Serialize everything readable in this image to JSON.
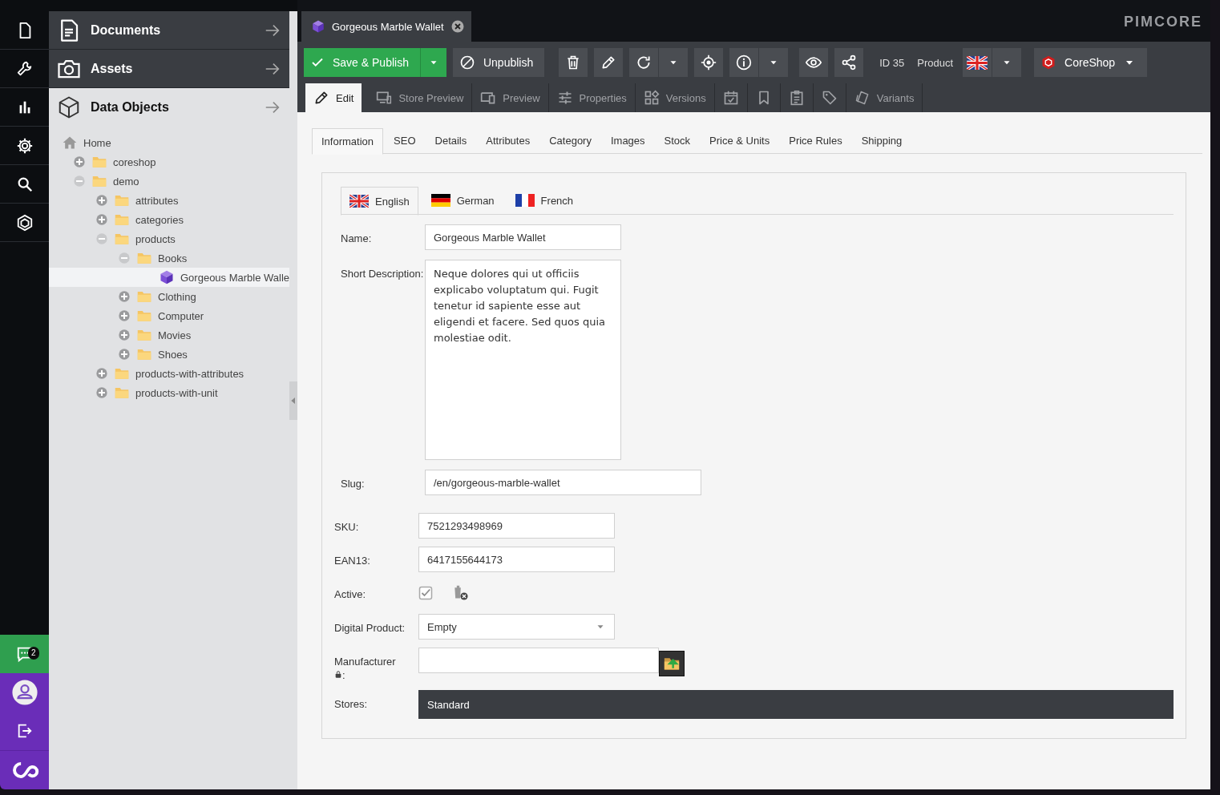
{
  "rail": {
    "notifications": {
      "count": "2"
    }
  },
  "sidebar": {
    "panels": [
      {
        "title": "Documents",
        "expanded": false
      },
      {
        "title": "Assets",
        "expanded": false
      },
      {
        "title": "Data Objects",
        "expanded": true
      }
    ],
    "tree": [
      {
        "label": "Home",
        "kind": "home",
        "selected": false,
        "children": [
          {
            "label": "coreshop",
            "kind": "folder",
            "expanded": false,
            "selected": false
          },
          {
            "label": "demo",
            "kind": "folder",
            "expanded": true,
            "selected": false,
            "children": [
              {
                "label": "attributes",
                "kind": "folder",
                "expanded": false,
                "selected": false
              },
              {
                "label": "categories",
                "kind": "folder",
                "expanded": false,
                "selected": false
              },
              {
                "label": "products",
                "kind": "folder",
                "expanded": true,
                "selected": false,
                "children": [
                  {
                    "label": "Books",
                    "kind": "folder",
                    "expanded": true,
                    "selected": false,
                    "children": [
                      {
                        "label": "Gorgeous Marble Walle",
                        "kind": "object",
                        "selected": true
                      }
                    ]
                  },
                  {
                    "label": "Clothing",
                    "kind": "folder",
                    "expanded": false,
                    "selected": false
                  },
                  {
                    "label": "Computer",
                    "kind": "folder",
                    "expanded": false,
                    "selected": false
                  },
                  {
                    "label": "Movies",
                    "kind": "folder",
                    "expanded": false,
                    "selected": false
                  },
                  {
                    "label": "Shoes",
                    "kind": "folder",
                    "expanded": false,
                    "selected": false
                  }
                ]
              },
              {
                "label": "products-with-attributes",
                "kind": "folder",
                "expanded": false,
                "selected": false
              },
              {
                "label": "products-with-unit",
                "kind": "folder",
                "expanded": false,
                "selected": false
              }
            ]
          }
        ]
      }
    ]
  },
  "editor": {
    "tab": {
      "title": "Gorgeous Marble Wallet"
    },
    "logo": "PIMCORE",
    "toolbar": [
      {
        "kind": "publish",
        "label": "Save & Publish"
      },
      {
        "kind": "unpublish",
        "label": "Unpublish"
      },
      {
        "kind": "delete"
      },
      {
        "kind": "rename"
      },
      {
        "kind": "reload"
      },
      {
        "kind": "caret"
      },
      {
        "kind": "locate"
      },
      {
        "kind": "info"
      },
      {
        "kind": "caret"
      },
      {
        "kind": "view"
      },
      {
        "kind": "share"
      },
      {
        "kind": "id",
        "label": "ID 35"
      },
      {
        "kind": "class",
        "label": "Product"
      },
      {
        "kind": "language"
      },
      {
        "kind": "caret"
      },
      {
        "kind": "store",
        "label": "CoreShop"
      }
    ],
    "view_tabs": [
      {
        "kind": "edit",
        "label": "Edit",
        "selected": true
      },
      {
        "kind": "store-preview",
        "label": "Store Preview",
        "selected": false
      },
      {
        "kind": "preview",
        "label": "Preview",
        "selected": false
      },
      {
        "kind": "properties",
        "label": "Properties",
        "selected": false
      },
      {
        "kind": "versions",
        "label": "Versions",
        "selected": false
      },
      {
        "kind": "schedule",
        "selected": false
      },
      {
        "kind": "notes",
        "selected": false
      },
      {
        "kind": "tasks",
        "selected": false
      },
      {
        "kind": "tags",
        "selected": false
      },
      {
        "kind": "variants",
        "label": "Variants",
        "selected": false
      }
    ],
    "tabs": [
      {
        "label": "Information",
        "selected": true
      },
      {
        "label": "SEO",
        "selected": false
      },
      {
        "label": "Details",
        "selected": false
      },
      {
        "label": "Attributes",
        "selected": false
      },
      {
        "label": "Category",
        "selected": false
      },
      {
        "label": "Images",
        "selected": false
      },
      {
        "label": "Stock",
        "selected": false
      },
      {
        "label": "Price & Units",
        "selected": false
      },
      {
        "label": "Price Rules",
        "selected": false
      },
      {
        "label": "Shipping",
        "selected": false
      }
    ],
    "languages": [
      {
        "label": "English",
        "selected": true
      },
      {
        "label": "German",
        "selected": false
      },
      {
        "label": "French",
        "selected": false
      }
    ],
    "localized_fields": [
      {
        "kind": "text",
        "label": "Name:",
        "value": "Gorgeous Marble Wallet"
      },
      {
        "kind": "textarea",
        "label": "Short Description:",
        "value": "Neque dolores qui ut officiis explicabo voluptatum qui. Fugit tenetur id sapiente esse aut eligendi et facere. Sed quos quia molestiae odit."
      },
      {
        "kind": "slug",
        "label": "Slug:",
        "value": "/en/gorgeous-marble-wallet"
      }
    ],
    "fields": [
      {
        "kind": "text",
        "label": "SKU:",
        "value": "7521293498969"
      },
      {
        "kind": "text",
        "label": "EAN13:",
        "value": "6417155644173"
      },
      {
        "kind": "checkbox",
        "label": "Active:",
        "checked": true
      },
      {
        "kind": "select",
        "label": "Digital Product:",
        "value": "Empty"
      },
      {
        "kind": "relation",
        "label": "Manufacturer",
        "label_end": ":",
        "locked": true
      },
      {
        "kind": "multiselect",
        "label": "Stores:",
        "options": [
          {
            "label": "Standard",
            "selected": true
          }
        ]
      }
    ]
  }
}
